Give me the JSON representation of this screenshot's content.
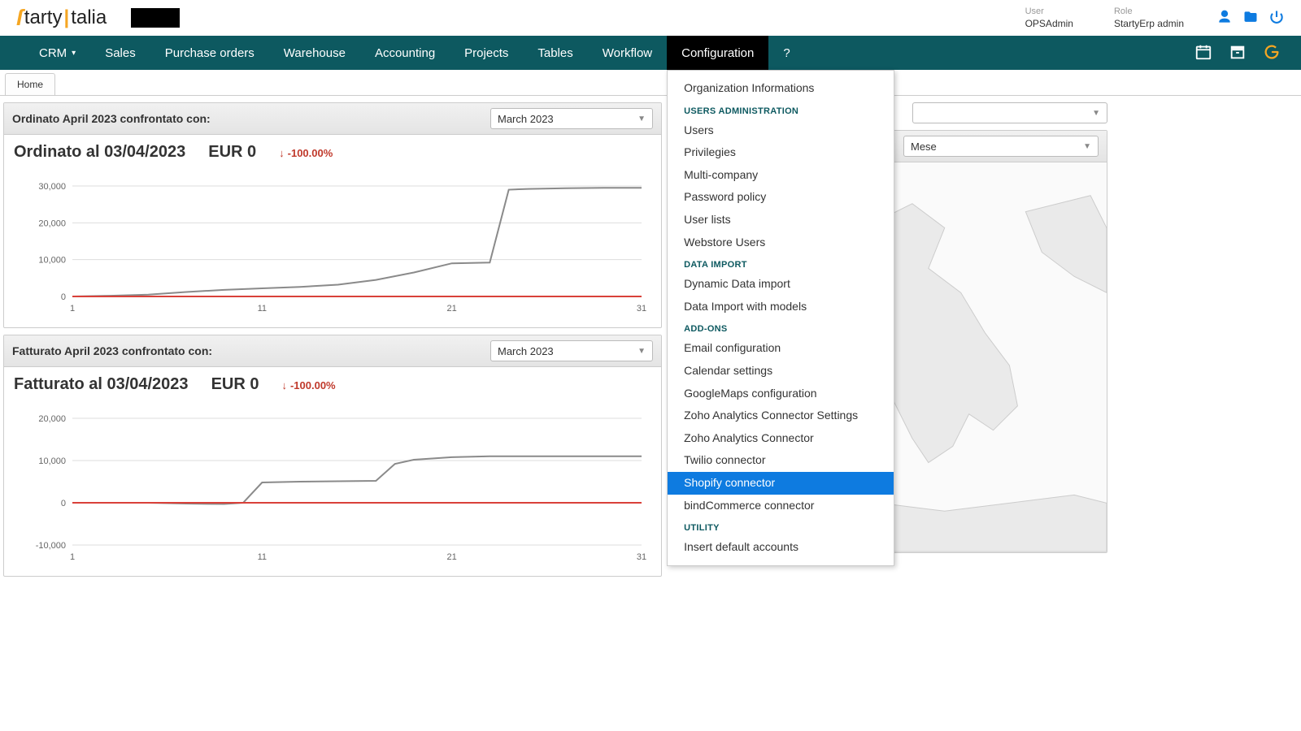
{
  "header": {
    "logo_text_a": "tarty",
    "logo_text_b": "talia",
    "user_label": "User",
    "user_value": "OPSAdmin",
    "role_label": "Role",
    "role_value": "StartyErp admin"
  },
  "nav": {
    "items": [
      "CRM",
      "Sales",
      "Purchase orders",
      "Warehouse",
      "Accounting",
      "Projects",
      "Tables",
      "Workflow",
      "Configuration",
      "?"
    ],
    "active": "Configuration"
  },
  "dropdown": {
    "top_item": "Organization Informations",
    "sections": [
      {
        "title": "USERS ADMINISTRATION",
        "items": [
          "Users",
          "Privilegies",
          "Multi-company",
          "Password policy",
          "User lists",
          "Webstore Users"
        ]
      },
      {
        "title": "DATA IMPORT",
        "items": [
          "Dynamic Data import",
          "Data Import with models"
        ]
      },
      {
        "title": "ADD-ONS",
        "items": [
          "Email configuration",
          "Calendar settings",
          "GoogleMaps configuration",
          "Zoho Analytics Connector Settings",
          "Zoho Analytics Connector",
          "Twilio connector",
          "Shopify connector",
          "bindCommerce connector"
        ]
      },
      {
        "title": "UTILITY",
        "items": [
          "Insert default accounts"
        ]
      }
    ],
    "highlighted": "Shopify connector"
  },
  "subtab": {
    "home": "Home"
  },
  "right_top_select": {
    "value": ""
  },
  "ordinato": {
    "panel_title": "Ordinato April 2023 confrontato con:",
    "compare_month": "March 2023",
    "period": "Mese",
    "sub_title": "Ordinato al 03/04/2023",
    "sub_value": "EUR 0",
    "delta": "-100.00%"
  },
  "fatturato": {
    "panel_title": "Fatturato April 2023 confrontato con:",
    "compare_month": "March 2023",
    "sub_title": "Fatturato al 03/04/2023",
    "sub_value": "EUR 0",
    "delta": "-100.00%"
  },
  "chart_data": [
    {
      "type": "line",
      "title": "Ordinato al 03/04/2023",
      "xlabel": "",
      "ylabel": "",
      "xlim": [
        1,
        31
      ],
      "ylim": [
        0,
        30000
      ],
      "x_ticks": [
        1,
        11,
        21,
        31
      ],
      "y_ticks": [
        0,
        10000,
        20000,
        30000
      ],
      "y_tick_labels": [
        "0",
        "10,000",
        "20,000",
        "30,000"
      ],
      "series": [
        {
          "name": "March 2023",
          "color": "#8a8a8a",
          "x": [
            1,
            3,
            5,
            7,
            9,
            11,
            13,
            15,
            17,
            19,
            21,
            23,
            24,
            25,
            27,
            29,
            31
          ],
          "values": [
            0,
            200,
            500,
            1200,
            1800,
            2200,
            2600,
            3200,
            4500,
            6500,
            9000,
            9200,
            29000,
            29200,
            29400,
            29500,
            29500
          ]
        },
        {
          "name": "April 2023",
          "color": "#d9413a",
          "x": [
            1,
            3,
            31
          ],
          "values": [
            0,
            0,
            0
          ]
        }
      ]
    },
    {
      "type": "line",
      "title": "Fatturato al 03/04/2023",
      "xlabel": "",
      "ylabel": "",
      "xlim": [
        1,
        31
      ],
      "ylim": [
        -10000,
        20000
      ],
      "x_ticks": [
        1,
        11,
        21,
        31
      ],
      "y_ticks": [
        -10000,
        0,
        10000,
        20000
      ],
      "y_tick_labels": [
        "-10,000",
        "0",
        "10,000",
        "20,000"
      ],
      "series": [
        {
          "name": "March 2023",
          "color": "#8a8a8a",
          "x": [
            1,
            3,
            5,
            7,
            9,
            10,
            11,
            13,
            15,
            17,
            18,
            19,
            21,
            23,
            25,
            27,
            29,
            31
          ],
          "values": [
            0,
            0,
            0,
            -200,
            -300,
            0,
            4800,
            5000,
            5100,
            5200,
            9200,
            10200,
            10800,
            11000,
            11000,
            11000,
            11000,
            11000
          ]
        },
        {
          "name": "April 2023",
          "color": "#d9413a",
          "x": [
            1,
            3,
            31
          ],
          "values": [
            0,
            0,
            0
          ]
        }
      ]
    }
  ]
}
